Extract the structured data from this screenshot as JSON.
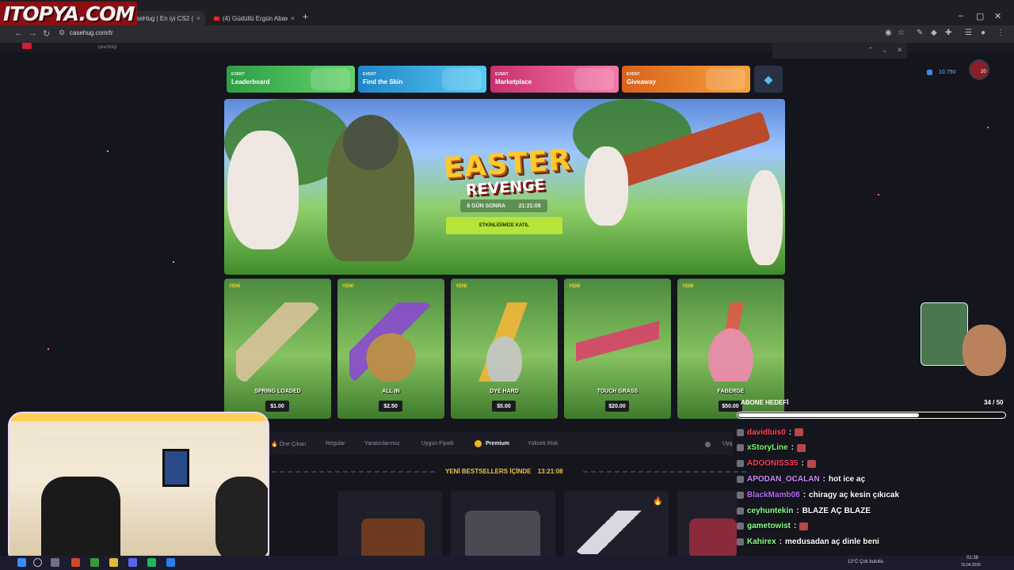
{
  "overlay_logo": "ITOPYA.COM",
  "browser": {
    "tabs": [
      {
        "label": "CaseHug | En iyi CS2 (CS:GO...",
        "close": "×"
      },
      {
        "label": "(4) Güdüllü Ergün Abaxoy 6...",
        "close": "×"
      }
    ],
    "new_tab": "+",
    "url": "casehug.com/tr",
    "window_controls": [
      "–",
      "▢",
      "✕"
    ]
  },
  "site": {
    "header_sub": "çevrimiçi",
    "balance": "10.750",
    "avatar_level": "20"
  },
  "events": [
    {
      "kicker": "EVENT",
      "title": "Leaderboard",
      "color": "#3fbf55"
    },
    {
      "kicker": "EVENT",
      "title": "Find the Skin",
      "color": "#2fa8e8"
    },
    {
      "kicker": "EVENT",
      "title": "Marketplace",
      "color": "#e0458a"
    },
    {
      "kicker": "EVENT",
      "title": "Giveaway",
      "color": "#f07a1e"
    }
  ],
  "hero": {
    "title": "EASTER",
    "subtitle": "REVENGE",
    "countdown_days": "8 GÜN SONRA",
    "countdown_time": "21:21:08",
    "cta": "ETKİNLİĞİMİZE KATIL"
  },
  "skins": [
    {
      "badge": "YENİ",
      "name": "SPRING LOADED",
      "price": "$1.00",
      "art_color": "#d9c29a"
    },
    {
      "badge": "YENİ",
      "name": "ALL IN",
      "price": "$2.50",
      "art_color": "#8a4bd0"
    },
    {
      "badge": "YENİ",
      "name": "DYE HARD",
      "price": "$5.00",
      "art_color": "#f2b63a"
    },
    {
      "badge": "YENİ",
      "name": "TOUCH GRASS",
      "price": "$20.00",
      "art_color": "#d8436a"
    },
    {
      "badge": "YENİ",
      "name": "FABERGE",
      "price": "$50.00",
      "art_color": "#e05a4a"
    }
  ],
  "categories": {
    "items": [
      "Öne Çıkan",
      "Regular",
      "Yaratıcılarımız",
      "Uygun Fiyatlı",
      "Premium",
      "Yüksek Risk"
    ],
    "active": "Premium",
    "trailing": "Uyg"
  },
  "bestsellers": {
    "label": "YENİ BESTSELLERS İÇİNDE",
    "time": "13:21:08"
  },
  "stream_overlay": {
    "goal_label": "ABONE HEDEFİ",
    "goal_count": "34 / 50",
    "goal_progress": 0.68,
    "chat": [
      {
        "user": "davidluis0",
        "sep": ":",
        "msg": "",
        "user_color": "#ff4a5e",
        "emote": true
      },
      {
        "user": "xStoryLine",
        "sep": ":",
        "msg": "",
        "user_color": "#7cff6a",
        "emote": true
      },
      {
        "user": "ADOONISS35",
        "sep": ":",
        "msg": "",
        "user_color": "#ff3b5c",
        "emote": true
      },
      {
        "user": "APODAN_OCALAN",
        "sep": ":",
        "msg": "hot ice aç",
        "user_color": "#c98bff",
        "emote": false
      },
      {
        "user": "BlackMamb08",
        "sep": ":",
        "msg": "chiragy aç kesin çıkıcak",
        "user_color": "#b36bff",
        "emote": false
      },
      {
        "user": "ceyhuntekin",
        "sep": ":",
        "msg": "BLAZE AÇ BLAZE",
        "user_color": "#8cff8c",
        "emote": false
      },
      {
        "user": "gametowist",
        "sep": ":",
        "msg": "",
        "user_color": "#8cff8c",
        "emote": true
      },
      {
        "user": "Kahirex",
        "sep": ":",
        "msg": "medusadan aç dinle beni",
        "user_color": "#8cff8c",
        "emote": false
      }
    ]
  },
  "taskbar": {
    "weather": "13°C  Çok bulutlu",
    "time": "01:38",
    "date": "15.04.2026"
  }
}
